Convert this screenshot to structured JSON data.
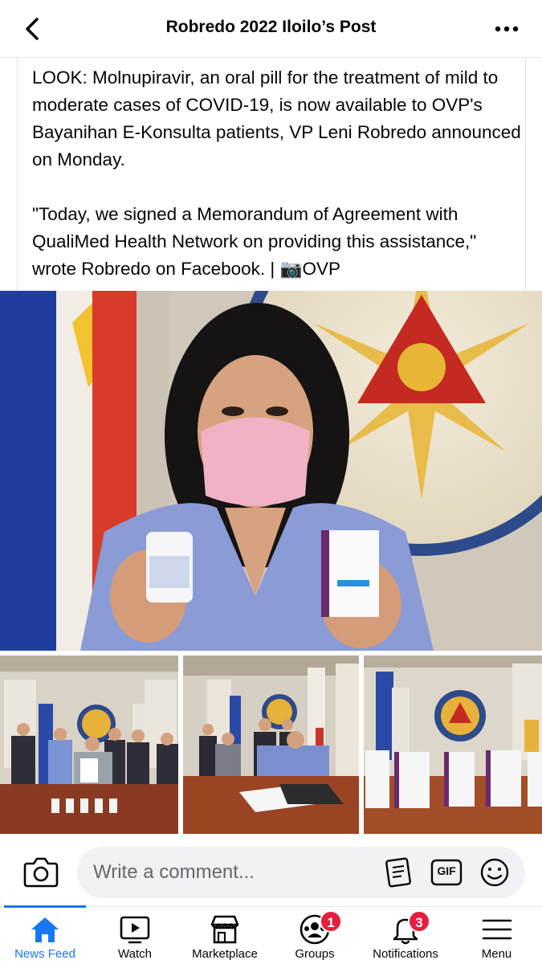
{
  "header": {
    "title": "Robredo 2022 Iloilo’s Post",
    "back_icon": "chevron-left-icon",
    "more_icon": "more-horizontal-icon"
  },
  "post": {
    "paragraph1": "LOOK: Molnupiravir, an oral pill for the treatment of mild to moderate cases of COVID-19, is now available to OVP's Bayanihan E-Konsulta patients, VP Leni Robredo announced on Monday.",
    "paragraph2_text": "\"Today, we signed a Memorandum of Agreement with QualiMed Health Network on providing this assistance,\" wrote Robredo on Facebook. | ",
    "paragraph2_emoji": "📷",
    "paragraph2_credit": "OVP"
  },
  "photos": {
    "main": "woman-holding-molnupiravir-photo",
    "thumbs": [
      "group-photo-with-memorandum",
      "man-signing-agreement-photo",
      "medicine-boxes-on-table-photo"
    ]
  },
  "comment_bar": {
    "placeholder": "Write a comment...",
    "icons": [
      "camera-icon",
      "sticker-icon",
      "gif-icon",
      "emoji-icon"
    ],
    "gif_label": "GIF"
  },
  "bottom_nav": {
    "items": [
      {
        "label": "News Feed",
        "icon": "home-icon",
        "active": true
      },
      {
        "label": "Watch",
        "icon": "watch-icon",
        "active": false
      },
      {
        "label": "Marketplace",
        "icon": "marketplace-icon",
        "active": false
      },
      {
        "label": "Groups",
        "icon": "groups-icon",
        "active": false,
        "badge": "1"
      },
      {
        "label": "Notifications",
        "icon": "bell-icon",
        "active": false,
        "badge": "3"
      },
      {
        "label": "Menu",
        "icon": "menu-icon",
        "active": false
      }
    ]
  },
  "colors": {
    "accent": "#1877f2",
    "badge": "#e41e3f",
    "input_bg": "#f0f2f5",
    "muted_text": "#65676b"
  }
}
